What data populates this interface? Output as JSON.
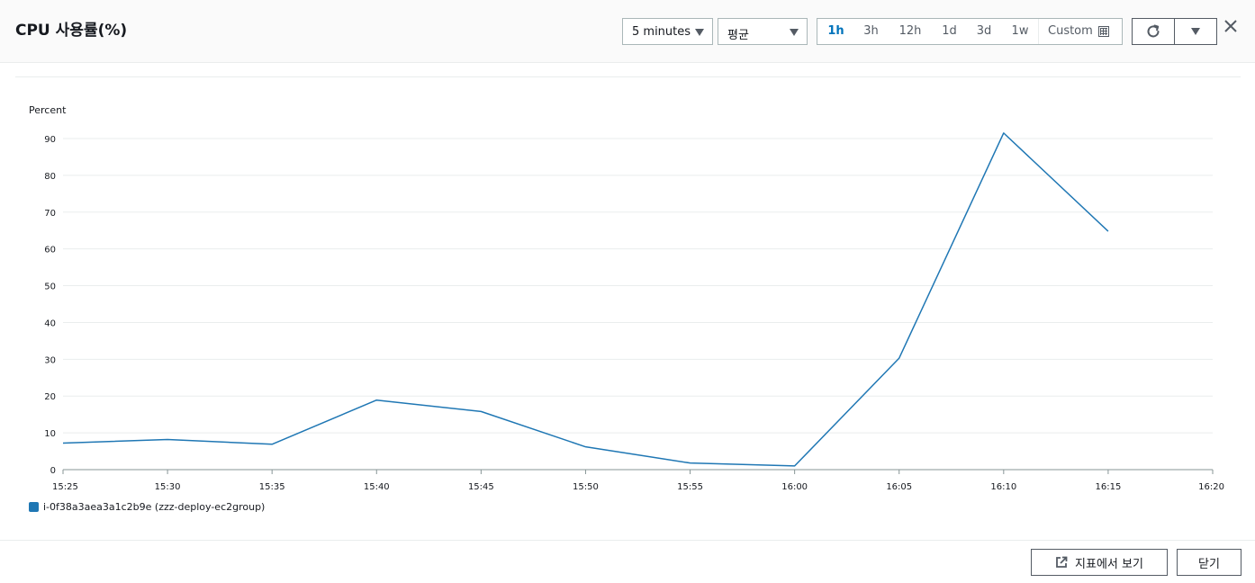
{
  "header": {
    "title": "CPU 사용률(%)",
    "period_select": "5 minutes",
    "statistic_select": "평균",
    "time_ranges": [
      "1h",
      "3h",
      "12h",
      "1d",
      "3d",
      "1w"
    ],
    "active_range": "1h",
    "custom_label": "Custom"
  },
  "icons": {
    "refresh": "refresh-icon",
    "dropdown": "chevron-down-icon",
    "close": "close-icon",
    "calendar": "calendar-icon",
    "external": "external-link-icon"
  },
  "chart_data": {
    "type": "line",
    "title": "",
    "ylabel": "Percent",
    "xlabel": "",
    "ylim": [
      0,
      90
    ],
    "yticks": [
      0,
      10,
      20,
      30,
      40,
      50,
      60,
      70,
      80,
      90
    ],
    "x_ticks": [
      "15:25",
      "15:30",
      "15:35",
      "15:40",
      "15:45",
      "15:50",
      "15:55",
      "16:00",
      "16:05",
      "16:10",
      "16:15",
      "16:20"
    ],
    "grid": true,
    "legend_position": "bottom-left",
    "series": [
      {
        "name": "i-0f38a3aea3a1c2b9e (zzz-deploy-ec2group)",
        "color": "#1f77b4",
        "x": [
          "15:25",
          "15:30",
          "15:35",
          "15:40",
          "15:45",
          "15:50",
          "15:55",
          "16:00",
          "16:05",
          "16:10",
          "16:15"
        ],
        "values": [
          7.2,
          8.2,
          6.9,
          18.9,
          15.8,
          6.2,
          1.8,
          1.0,
          30.3,
          91.5,
          64.8
        ]
      }
    ]
  },
  "footer": {
    "view_in_metrics": "지표에서 보기",
    "close": "닫기"
  }
}
